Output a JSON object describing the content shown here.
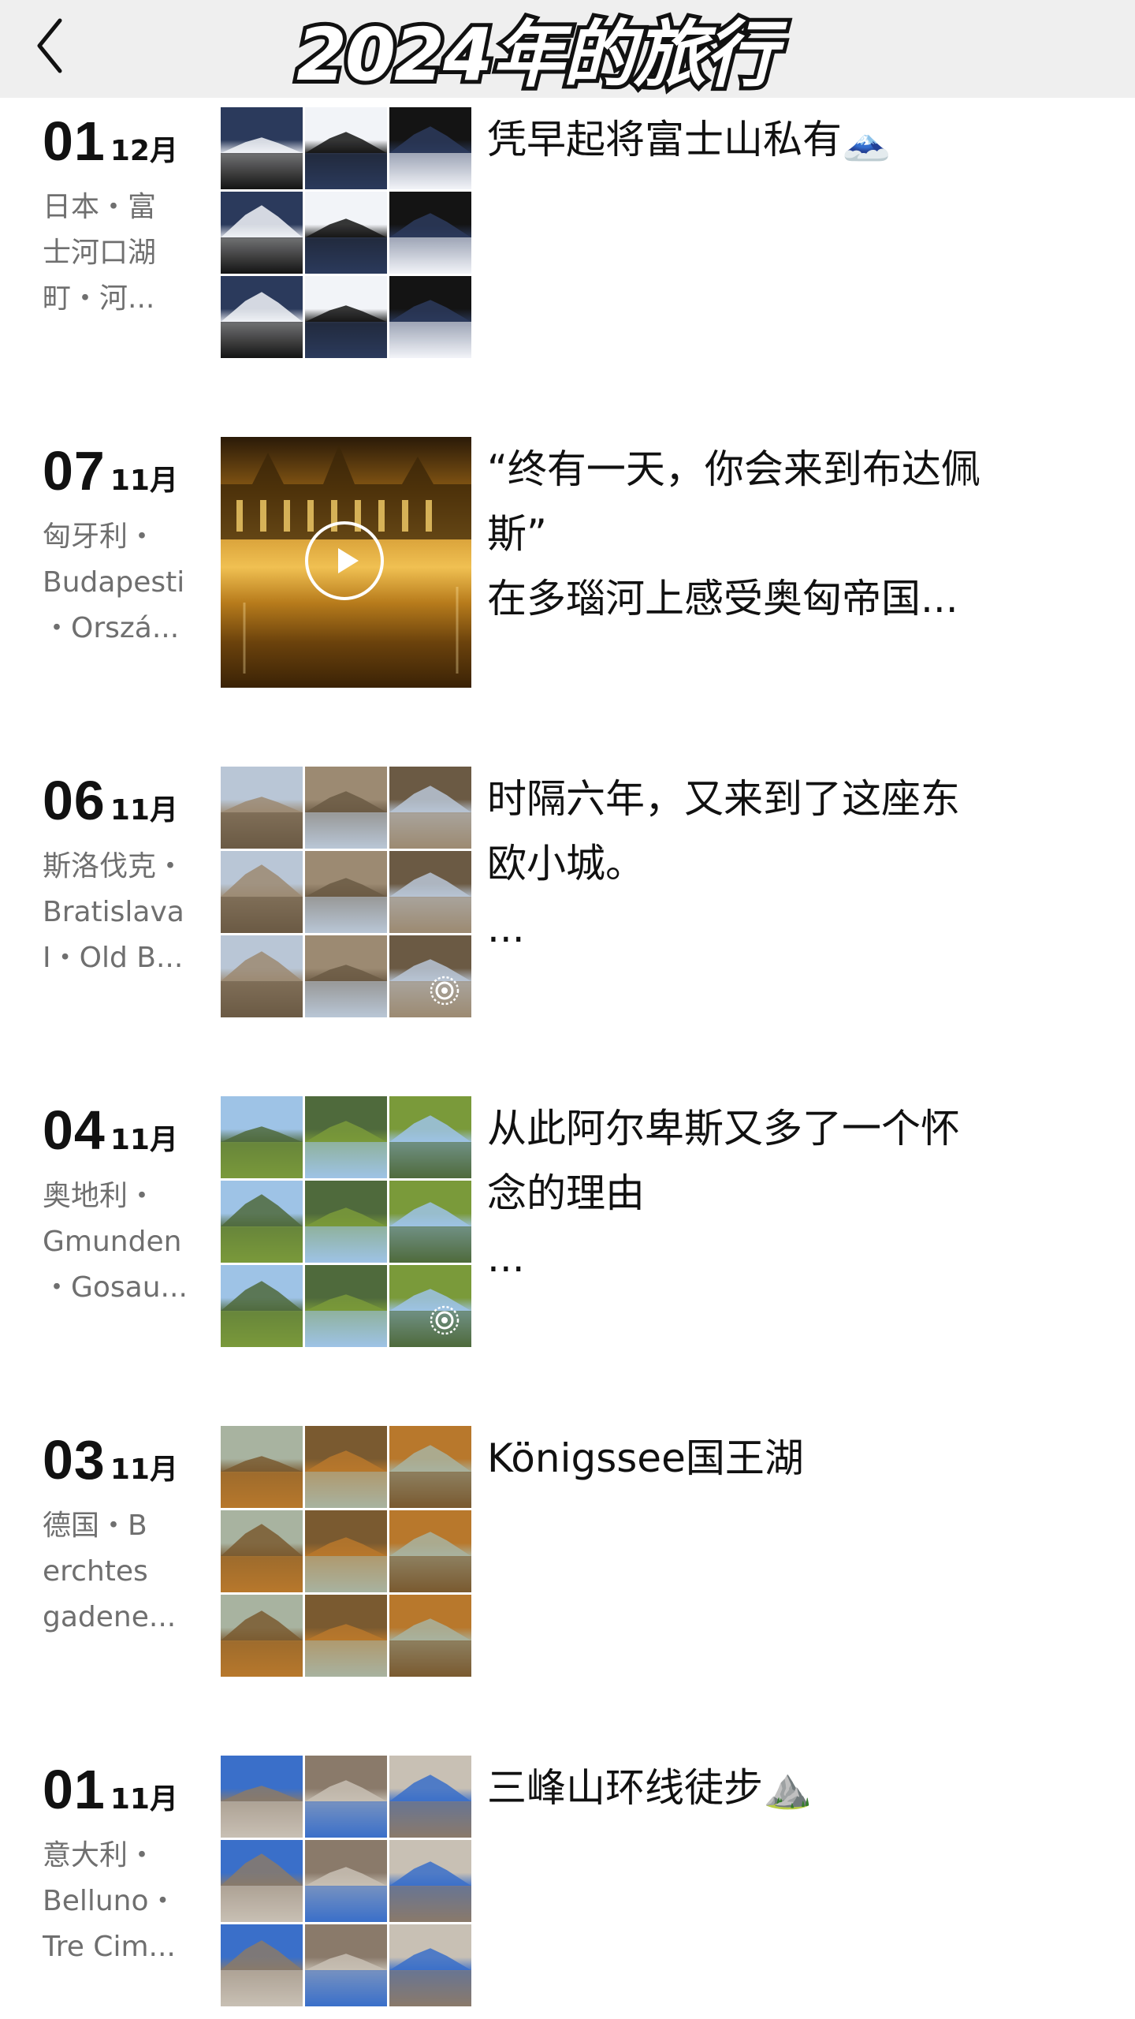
{
  "header": {
    "title": "2024年的旅行",
    "back_icon": "chevron-left-icon"
  },
  "entries": [
    {
      "day": "01",
      "month": "12月",
      "location_lines": [
        "日本・富",
        "士河口湖",
        "町・河..."
      ],
      "caption_lines": [
        "凭早起将富士山私有🗻"
      ],
      "media": "grid",
      "badge": "",
      "palette": [
        "#2b3a5c",
        "#f2f4f8",
        "#141414"
      ]
    },
    {
      "day": "07",
      "month": "11月",
      "location_lines": [
        "匈牙利・",
        "Budapesti",
        "・Orszá..."
      ],
      "caption_lines": [
        "“终有一天，你会来到布达佩",
        "斯”",
        "在多瑙河上感受奥匈帝国..."
      ],
      "media": "video",
      "badge": "play-icon",
      "palette": [
        "#d9a23a",
        "#6b420c",
        "#2a1a08"
      ]
    },
    {
      "day": "06",
      "month": "11月",
      "location_lines": [
        "斯洛伐克・",
        "Bratislava",
        "I・Old B..."
      ],
      "caption_lines": [
        "时隔六年，又来到了这座东",
        "欧小城。",
        "..."
      ],
      "media": "grid",
      "badge": "live-photo-icon",
      "palette": [
        "#b9c6d6",
        "#9c8a72",
        "#6b5a44"
      ]
    },
    {
      "day": "04",
      "month": "11月",
      "location_lines": [
        "奥地利・",
        "Gmunden",
        "・Gosau..."
      ],
      "caption_lines": [
        "从此阿尔卑斯又多了一个怀",
        "念的理由",
        "..."
      ],
      "media": "grid",
      "badge": "live-photo-icon",
      "palette": [
        "#9ec3e6",
        "#4f6a3c",
        "#7a9a3a"
      ]
    },
    {
      "day": "03",
      "month": "11月",
      "location_lines": [
        "德国・B",
        "erchtes",
        "gadene..."
      ],
      "caption_lines": [
        "Königssee国王湖"
      ],
      "media": "grid",
      "badge": "",
      "palette": [
        "#a8b3a0",
        "#7a5a30",
        "#b8782c"
      ]
    },
    {
      "day": "01",
      "month": "11月",
      "location_lines": [
        "意大利・",
        "Belluno・",
        "Tre Cim..."
      ],
      "caption_lines": [
        "三峰山环线徒步⛰️"
      ],
      "media": "grid",
      "badge": "",
      "palette": [
        "#3a6fc9",
        "#8a7a6a",
        "#c8c0b4"
      ]
    }
  ]
}
